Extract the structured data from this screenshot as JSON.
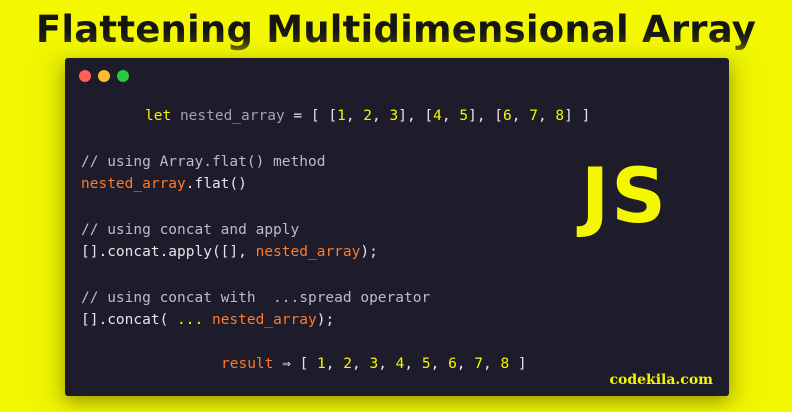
{
  "title": "Flattening Multidimensional Array",
  "window": {
    "dots": [
      "close",
      "minimize",
      "maximize"
    ]
  },
  "code": {
    "line1": {
      "kw": "let",
      "name": "nested_array",
      "eq": " = [ [",
      "n1": "1",
      "c1": ", ",
      "n2": "2",
      "c2": ", ",
      "n3": "3",
      "c3": "], [",
      "n4": "4",
      "c4": ", ",
      "n5": "5",
      "c5": "], [",
      "n6": "6",
      "c6": ", ",
      "n7": "7",
      "c7": ", ",
      "n8": "8",
      "c8": "] ]"
    },
    "comment1": "// using Array.flat() method",
    "line2": {
      "var": "nested_array",
      "rest": ".flat()"
    },
    "comment2": "// using concat and apply",
    "line3": {
      "pre": "[].concat.apply([], ",
      "var": "nested_array",
      "post": ");"
    },
    "comment3": "// using concat with  ...spread operator",
    "line4": {
      "pre": "[].concat( ",
      "spread": "...",
      "var": " nested_array",
      "post": ");"
    },
    "result": {
      "label": "result",
      "arrow": " ⇒ [ ",
      "values": [
        "1",
        "2",
        "3",
        "4",
        "5",
        "6",
        "7",
        "8"
      ],
      "close": " ]"
    }
  },
  "logo_text": "JS",
  "brand": "codekila.com",
  "colors": {
    "background": "#f3f800",
    "window": "#1e1c2a",
    "keyword": "#f3f800",
    "variable": "#ff7a2b",
    "text": "#e4e4ea"
  }
}
